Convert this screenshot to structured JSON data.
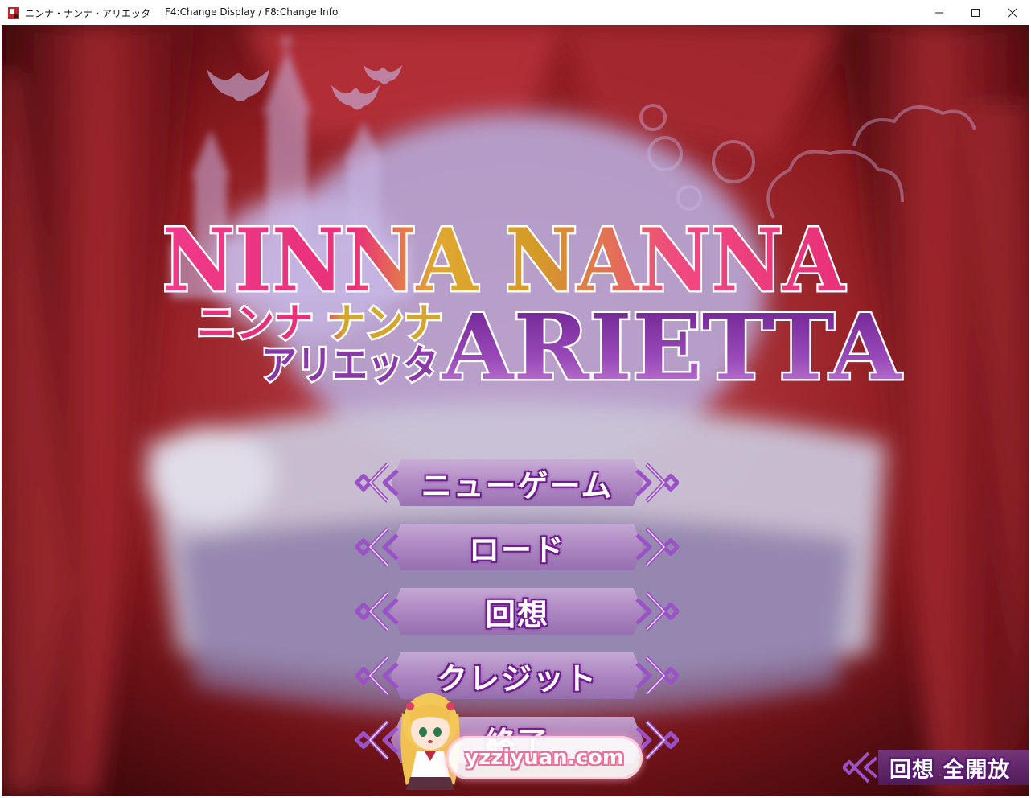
{
  "window": {
    "title": "ニンナ・ナンナ・アリエッタ",
    "info": "F4:Change Display / F8:Change Info",
    "minimize_symbol": "─",
    "close_symbol": "✕"
  },
  "logo": {
    "line1": "NINNA NANNA",
    "line2": "ARIETTA",
    "jp_line1": "ニンナ ナンナ",
    "jp_line2": "アリエッタ"
  },
  "menu": {
    "items": [
      {
        "label": "ニューゲーム"
      },
      {
        "label": "ロード"
      },
      {
        "label": "回想"
      },
      {
        "label": "クレジット"
      },
      {
        "label": "終了"
      }
    ]
  },
  "unlock_button": {
    "label": "回想 全開放"
  },
  "watermark": {
    "text": "yzziyuan.com"
  },
  "colors": {
    "menu_bar": "#b48ccb",
    "menu_outline": "#6a1a8a",
    "ornament": "#9b52c8",
    "curtain": "#8b1a1f",
    "logo_pink": "#e8307a",
    "logo_gold": "#d4a72c",
    "logo_purple": "#8a3aa8"
  }
}
